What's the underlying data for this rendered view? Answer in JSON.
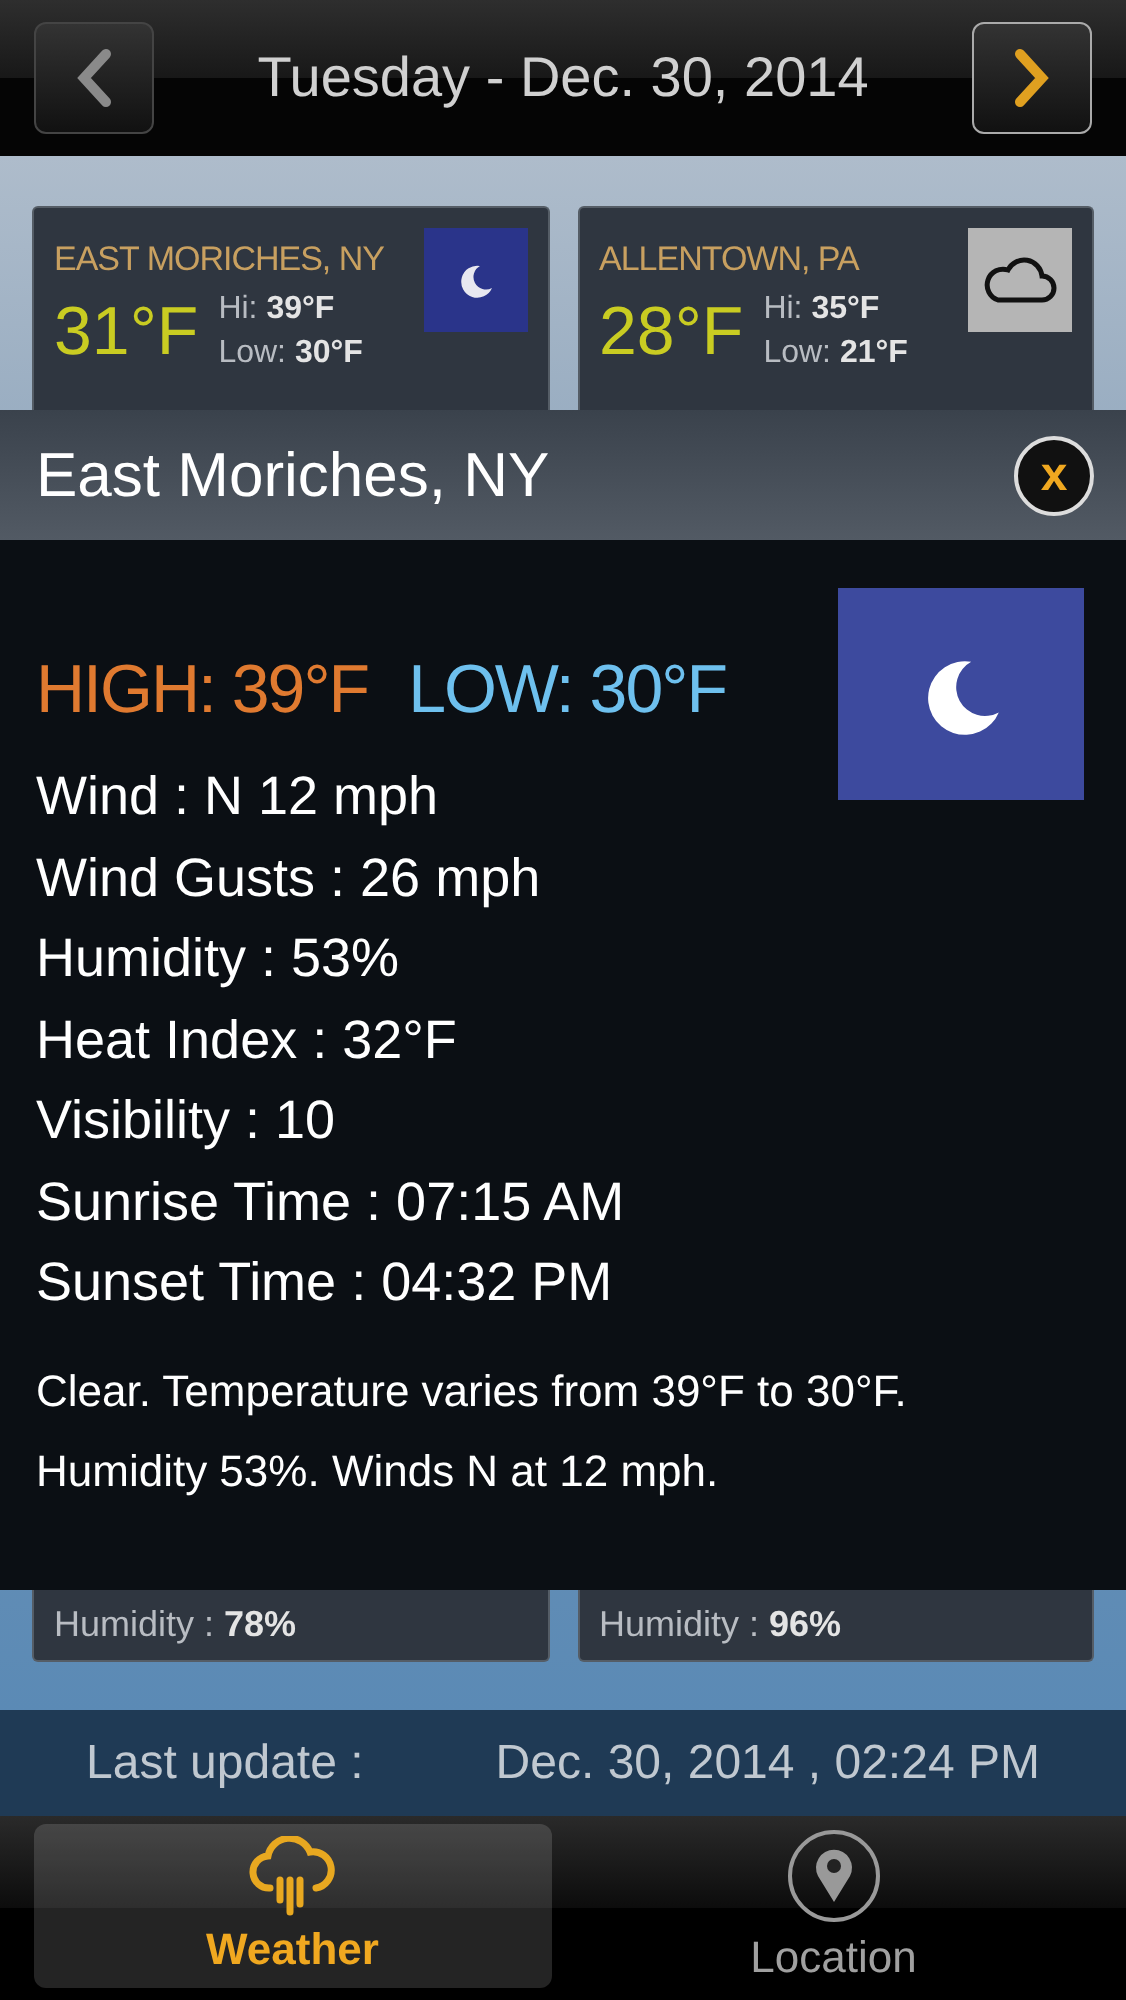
{
  "header": {
    "date": "Tuesday - Dec. 30, 2014"
  },
  "top_cards": [
    {
      "city": "EAST MORICHES, NY",
      "temp": "31°F",
      "hi_label": "Hi:",
      "hi": "39°F",
      "low_label": "Low:",
      "low": "30°F",
      "kind": "moon"
    },
    {
      "city": "ALLENTOWN, PA",
      "temp": "28°F",
      "hi_label": "Hi:",
      "hi": "35°F",
      "low_label": "Low:",
      "low": "21°F",
      "kind": "cloud"
    }
  ],
  "popup": {
    "title": "East Moriches, NY",
    "close": "x",
    "high": "HIGH: 39°F",
    "low": "LOW: 30°F",
    "kind": "moon",
    "details": [
      "Wind :  N 12 mph",
      "Wind Gusts : 26 mph",
      "Humidity : 53%",
      "Heat Index : 32°F",
      "Visibility : 10",
      "Sunrise Time : 07:15 AM",
      "Sunset Time : 04:32 PM"
    ],
    "description": "Clear. Temperature varies from 39°F to 30°F. Humidity 53%. Winds N at 12 mph."
  },
  "bottom_cards": [
    {
      "humidity_label": "Humidity :",
      "humidity": "78%"
    },
    {
      "humidity_label": "Humidity :",
      "humidity": "96%"
    }
  ],
  "last_update": {
    "label": "Last update :",
    "value": "Dec. 30, 2014 , 02:24 PM"
  },
  "tabs": [
    {
      "label": "Weather",
      "kind": "rain",
      "selected": true
    },
    {
      "label": "Location",
      "kind": "pin",
      "selected": false
    }
  ]
}
